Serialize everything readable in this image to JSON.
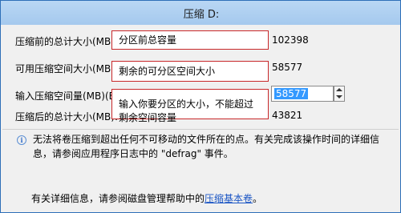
{
  "window": {
    "title": "压缩 D:"
  },
  "rows": [
    {
      "label": "压缩前的总计大小(MB):",
      "value": "102398",
      "annotation": "分区前总容量"
    },
    {
      "label": "可用压缩空间大小(MB):",
      "value": "58577",
      "annotation": "剩余的可分区空间大小"
    },
    {
      "label": "输入压缩空间量(MB)(E):",
      "value": "58577",
      "annotation": "输入你要分区的大小，不能超过"
    },
    {
      "label": "压缩后的总计大小(MB):",
      "value": "43821",
      "annotation": "剩余空间容量"
    }
  ],
  "info": {
    "icon": "info-icon",
    "text": "无法将卷压缩到超出任何不可移动的文件所在的点。有关完成该操作时间的详细信息，请参阅应用程序日志中的 \"defrag\" 事件。"
  },
  "footer": {
    "text": "有关详细信息，请参阅磁盘管理帮助中的",
    "link": "压缩基本卷",
    "end": "。"
  },
  "colors": {
    "annotation_border": "#c8282a",
    "titlebar": "#b9d7f4",
    "selection": "#3399ff",
    "link": "#1a55c4"
  }
}
